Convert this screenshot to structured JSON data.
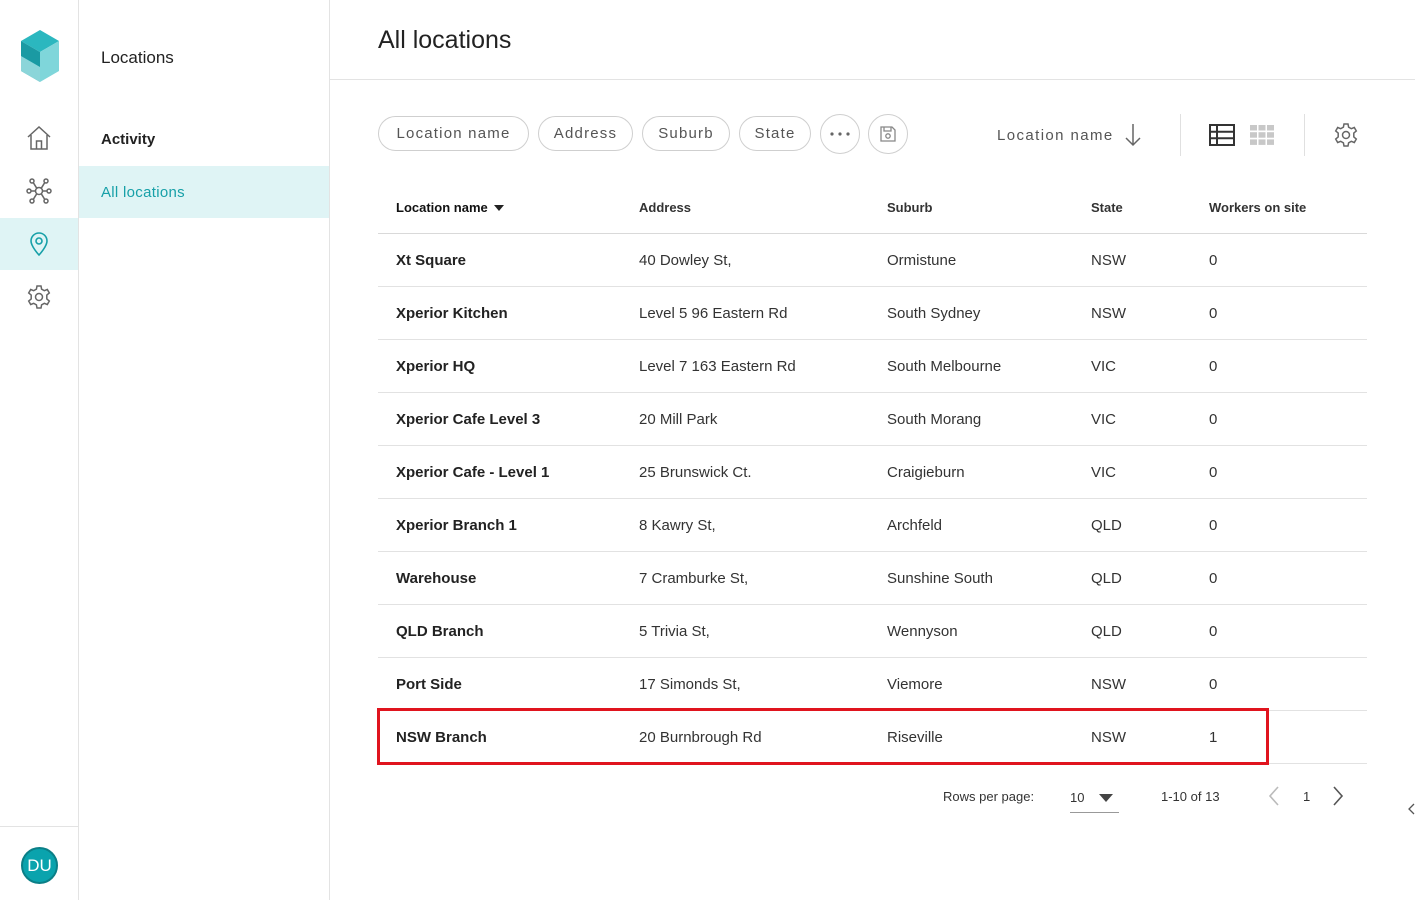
{
  "app": {
    "nav_icons": [
      "home-icon",
      "network-icon",
      "location-pin-icon",
      "gear-icon"
    ],
    "active_nav": "location-pin-icon",
    "accent_color": "#17a0a8",
    "highlight_color": "#e0141e",
    "user_initials": "DU"
  },
  "subnav": {
    "title": "Locations",
    "items": [
      {
        "label": "Activity",
        "active": false
      },
      {
        "label": "All locations",
        "active": true
      }
    ]
  },
  "page": {
    "title": "All locations"
  },
  "toolbar": {
    "filters": [
      "Location name",
      "Address",
      "Suburb",
      "State"
    ],
    "more_icon": "ellipsis-icon",
    "save_icon": "save-icon",
    "sort_label": "Location name",
    "sort_direction_icon": "arrow-down-icon",
    "view_list_icon": "list-view-icon",
    "view_grid_icon": "grid-view-icon",
    "settings_icon": "gear-icon"
  },
  "table": {
    "columns": [
      "Location name",
      "Address",
      "Suburb",
      "State",
      "Workers on site"
    ],
    "rows": [
      {
        "name": "Xt Square",
        "address": "40 Dowley St,",
        "suburb": "Ormistune",
        "state": "NSW",
        "workers": "0"
      },
      {
        "name": "Xperior Kitchen",
        "address": "Level 5 96 Eastern Rd",
        "suburb": "South Sydney",
        "state": "NSW",
        "workers": "0"
      },
      {
        "name": "Xperior HQ",
        "address": "Level 7 163 Eastern Rd",
        "suburb": "South Melbourne",
        "state": "VIC",
        "workers": "0"
      },
      {
        "name": "Xperior Cafe Level 3",
        "address": "20 Mill Park",
        "suburb": "South Morang",
        "state": "VIC",
        "workers": "0"
      },
      {
        "name": "Xperior Cafe - Level 1",
        "address": "25 Brunswick Ct.",
        "suburb": "Craigieburn",
        "state": "VIC",
        "workers": "0"
      },
      {
        "name": "Xperior Branch 1",
        "address": "8 Kawry St,",
        "suburb": "Archfeld",
        "state": "QLD",
        "workers": "0"
      },
      {
        "name": "Warehouse",
        "address": "7 Cramburke St,",
        "suburb": "Sunshine South",
        "state": "QLD",
        "workers": "0"
      },
      {
        "name": "QLD Branch",
        "address": "5 Trivia St,",
        "suburb": "Wennyson",
        "state": "QLD",
        "workers": "0"
      },
      {
        "name": "Port Side",
        "address": "17 Simonds St,",
        "suburb": "Viemore",
        "state": "NSW",
        "workers": "0"
      },
      {
        "name": "NSW Branch",
        "address": "20 Burnbrough Rd",
        "suburb": "Riseville",
        "state": "NSW",
        "workers": "1"
      }
    ],
    "highlighted_row": 9
  },
  "pagination": {
    "rows_per_page_label": "Rows per page:",
    "rows_per_page": "10",
    "range": "1-10 of 13",
    "page": "1"
  }
}
